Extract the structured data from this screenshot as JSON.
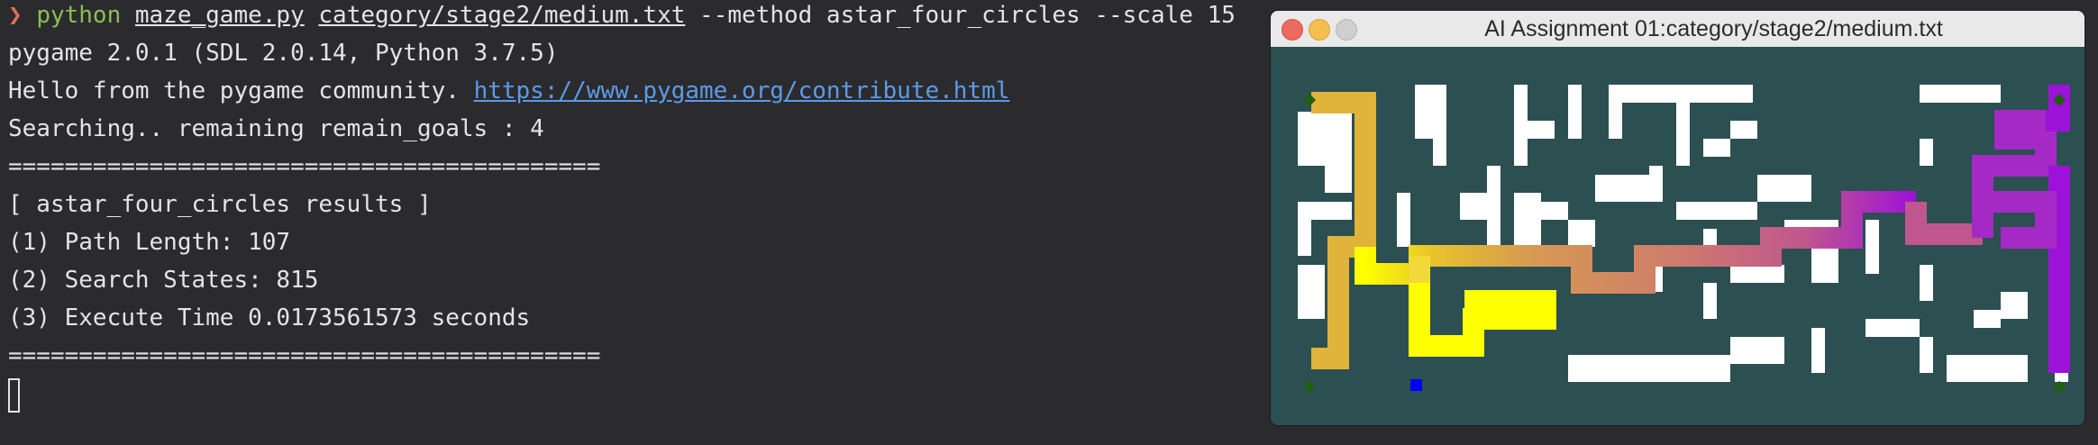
{
  "terminal": {
    "prompt_symbol": "❯",
    "command": {
      "program": "python",
      "script": "maze_game.py",
      "map_file": "category/stage2/medium.txt",
      "args": "--method astar_four_circles --scale 15"
    },
    "output": {
      "pygame_version": "pygame 2.0.1 (SDL 2.0.14, Python 3.7.5)",
      "hello_prefix": "Hello from the pygame community. ",
      "hello_link": "https://www.pygame.org/contribute.html",
      "searching": "Searching.. remaining remain_goals : 4",
      "separator": "==========================================",
      "results_header": "[ astar_four_circles results ]",
      "path_length": "(1) Path Length: 107",
      "search_states": "(2) Search States: 815",
      "execute_time": "(3) Execute Time 0.0173561573 seconds"
    }
  },
  "game_window": {
    "title": "AI Assignment 01:category/stage2/medium.txt",
    "buttons": [
      "close",
      "minimize",
      "maximize"
    ],
    "maze": {
      "wall_color": "#2c4f52",
      "open_color": "#ffffff",
      "goal_color": "#1f5f12",
      "start_color": "#0000ff",
      "goals": 4,
      "path_gradient": [
        "#ffff00",
        "#e8c32a",
        "#d69a52",
        "#cf7e69",
        "#c0568e",
        "#9d12d8"
      ]
    }
  }
}
